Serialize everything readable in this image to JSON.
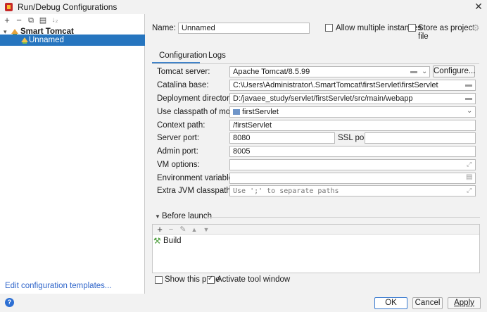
{
  "window": {
    "title": "Run/Debug Configurations",
    "close_icon": "close-icon"
  },
  "left_toolbar": {
    "add": "+",
    "remove": "−",
    "copy": "⧉",
    "move": "▤",
    "sort": "↓₂"
  },
  "tree": {
    "group_label": "Smart Tomcat",
    "item_label": "Unnamed"
  },
  "left_footer": {
    "edit_templates": "Edit configuration templates..."
  },
  "header": {
    "name_label": "Name:",
    "name_value": "Unnamed",
    "allow_multiple": "Allow multiple instances",
    "store_as_project_file": "Store as project file"
  },
  "tabs": [
    {
      "label": "Configuration",
      "active": true
    },
    {
      "label": "Logs",
      "active": false
    }
  ],
  "form": {
    "tomcat_server_label": "Tomcat server:",
    "tomcat_server_value": "Apache Tomcat/8.5.99",
    "configure_button": "Configure...",
    "catalina_base_label": "Catalina base:",
    "catalina_base_value": "C:\\Users\\Administrator\\.SmartTomcat\\firstServlet\\firstServlet",
    "deployment_dir_label": "Deployment directory:",
    "deployment_dir_value": "D:/javaee_study/servlet/firstServlet/src/main/webapp",
    "classpath_module_label": "Use classpath of module:",
    "classpath_module_value": "firstServlet",
    "context_path_label": "Context path:",
    "context_path_value": "/firstServlet",
    "server_port_label": "Server port:",
    "server_port_value": "8080",
    "ssl_port_label": "SSL port:",
    "ssl_port_value": "",
    "admin_port_label": "Admin port:",
    "admin_port_value": "8005",
    "vm_options_label": "VM options:",
    "vm_options_value": "",
    "env_vars_label": "Environment variables:",
    "env_vars_value": "",
    "extra_jvm_label": "Extra JVM classpath:",
    "extra_jvm_placeholder": "Use ';' to separate paths"
  },
  "before_launch": {
    "title": "Before launch",
    "items": [
      {
        "label": "Build"
      }
    ]
  },
  "bottom": {
    "show_this_page": "Show this page",
    "activate_tool_window": "Activate tool window",
    "ok": "OK",
    "cancel": "Cancel",
    "apply": "Apply"
  },
  "colors": {
    "selection": "#2675bf",
    "link": "#2f65ca",
    "accent": "#4083c9"
  }
}
